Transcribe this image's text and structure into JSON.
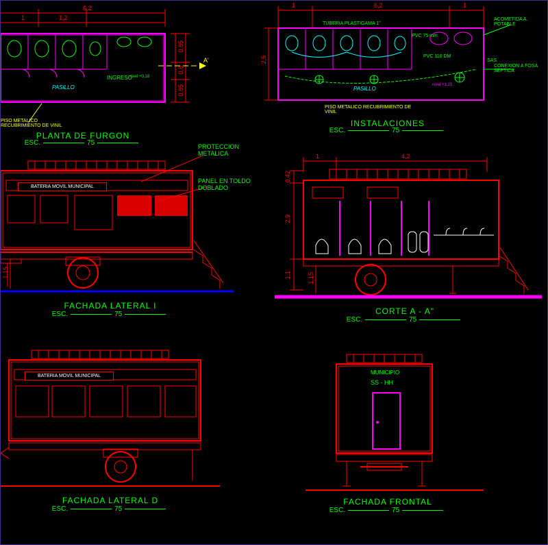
{
  "views": {
    "plan": {
      "title": "PLANTA DE FURGON",
      "scale_prefix": "ESC.",
      "scale_value": "75",
      "dims": {
        "width": "6,2",
        "seg1": "1",
        "seg2": "1,2",
        "h1": "0,85",
        "h2": "0,8",
        "h3": "0,85"
      },
      "labels": {
        "pasillo": "PASILLO",
        "ingreso": "INGRESO",
        "nivel": "nivel +0.18",
        "piso": "PISO METALICO RECUBRIMIENTO DE VINIL",
        "a": "A'"
      }
    },
    "installations": {
      "title": "INSTALACIONES",
      "scale_prefix": "ESC.",
      "scale_value": "75",
      "dims": {
        "width": "6,2",
        "seg1": "1",
        "seg2": "1",
        "height": "2,5"
      },
      "labels": {
        "pasillo": "PASILLO",
        "tuberia": "TUBERIA PLASTIGAMA 1\"",
        "pvc1": "PVC 75 mm",
        "pvc2": "PVC 110 DM",
        "acometida": "ACOMETIDA A. POTABLE",
        "conexion": "CONEXION A FOSA SEPTICA",
        "piso": "PISO METALICO RECUBRIMIENTO DE VINIL",
        "sas": "SAS",
        "nivel": "nivel +1.15"
      }
    },
    "lateral_i": {
      "title": "FACHADA LATERAL I",
      "scale_prefix": "ESC.",
      "scale_value": "75",
      "sign": "BATERIA MOVIL MUNICIPAL",
      "dims": {
        "h": "1,15"
      },
      "callouts": {
        "proteccion": "PROTECCION METALICA",
        "panel": "PANEL EN TOLDO DOBLADO"
      }
    },
    "corte": {
      "title": "CORTE A - A\"",
      "scale_prefix": "ESC.",
      "scale_value": "75",
      "dims": {
        "seg1": "1",
        "width": "4,2",
        "top": "0,42",
        "mid": "2,9",
        "bot": "1,1",
        "wheel": "1,15"
      }
    },
    "lateral_d": {
      "title": "FACHADA LATERAL D",
      "scale_prefix": "ESC.",
      "scale_value": "75",
      "sign": "BATERIA MOVIL MUNICIPAL"
    },
    "frontal": {
      "title": "FACHADA FRONTAL",
      "scale_prefix": "ESC.",
      "scale_value": "75",
      "labels": {
        "municipio": "MUNICIPIO",
        "ss": "SS - HH"
      }
    }
  }
}
